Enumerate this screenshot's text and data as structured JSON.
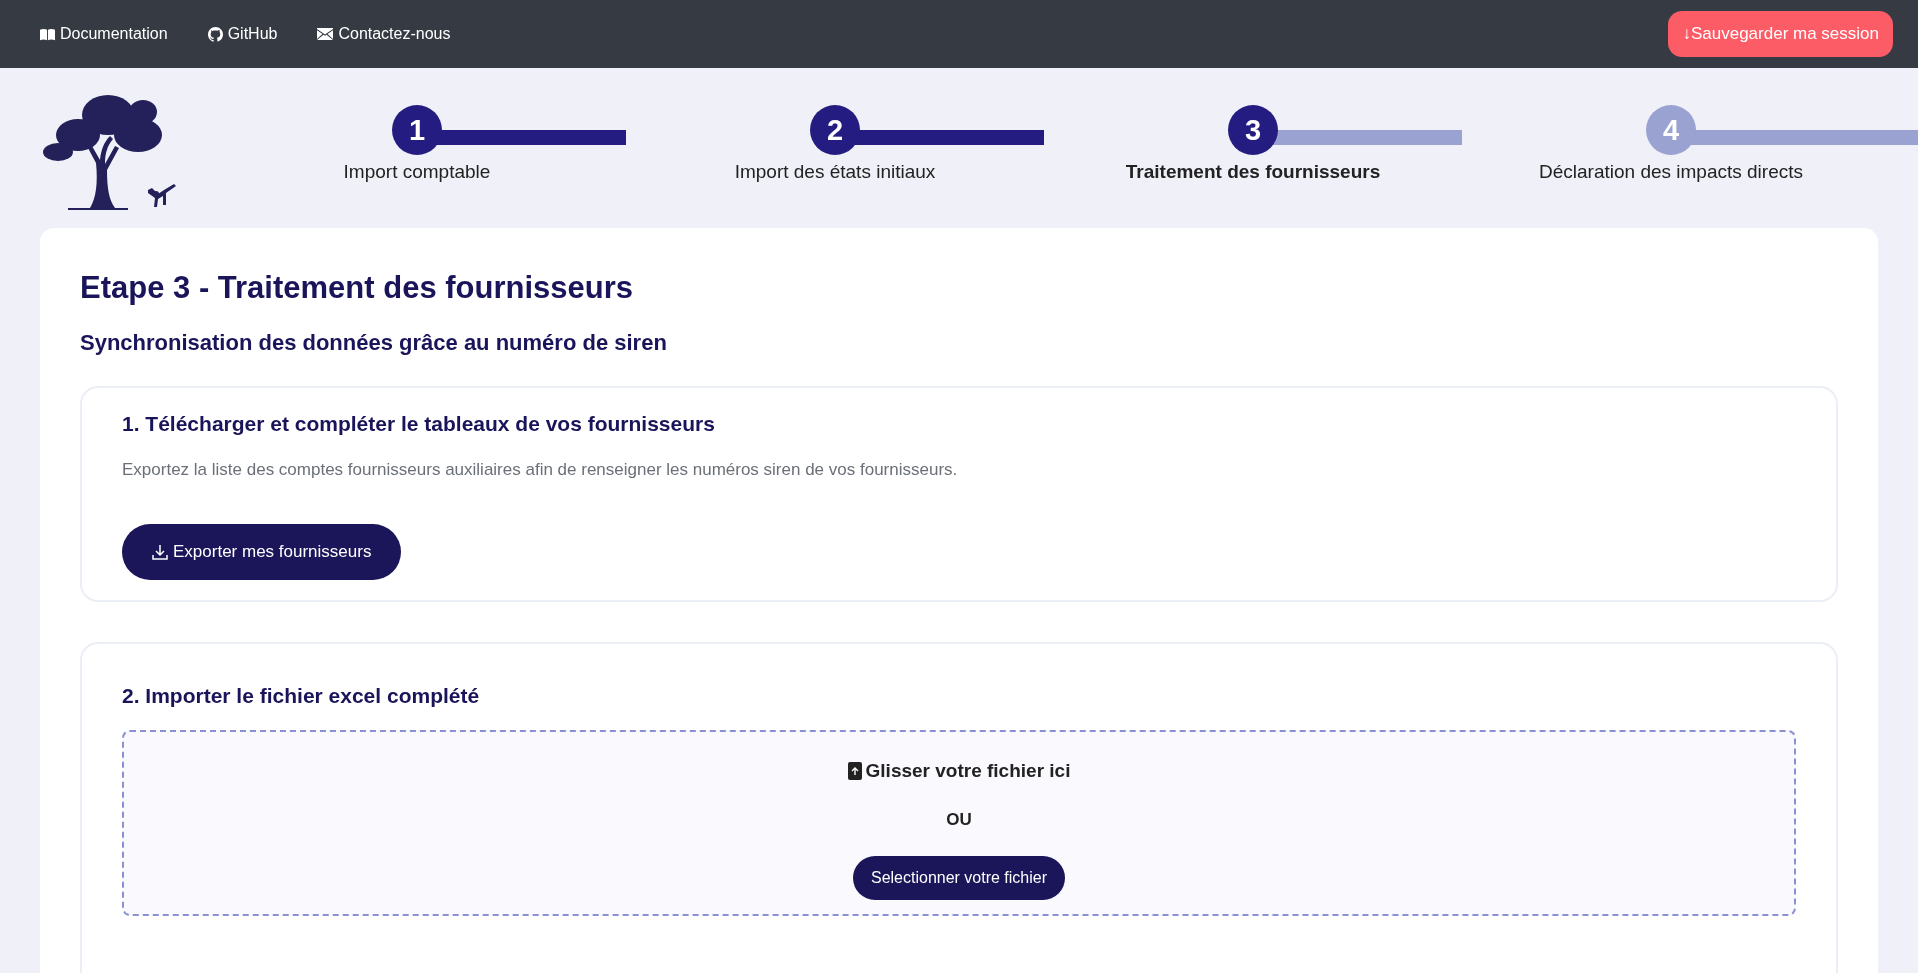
{
  "top_nav": {
    "links": [
      {
        "label": "Documentation",
        "kind": "book"
      },
      {
        "label": "GitHub",
        "kind": "github"
      },
      {
        "label": "Contactez-nous",
        "kind": "mail"
      }
    ],
    "save_button": {
      "arrow": "↓",
      "label": "Sauvegarder ma session"
    }
  },
  "stepper": [
    {
      "number": "1",
      "label": "Import comptable",
      "completed": true,
      "selected": false
    },
    {
      "number": "2",
      "label": "Import des états initiaux",
      "completed": true,
      "selected": false
    },
    {
      "number": "3",
      "label": "Traitement des fournisseurs",
      "completed": false,
      "selected": true
    },
    {
      "number": "4",
      "label": "Déclaration des impacts directs",
      "completed": false,
      "selected": false
    }
  ],
  "main": {
    "title": "Etape 3 - Traitement des fournisseurs",
    "subtitle": "Synchronisation des données grâce au numéro de siren",
    "export_section": {
      "heading": "1. Télécharger et compléter le tableaux de vos fournisseurs",
      "description": "Exportez la liste des comptes fournisseurs auxiliaires afin de renseigner les numéros siren de vos fournisseurs.",
      "button": "Exporter mes fournisseurs"
    },
    "import_section": {
      "heading": "2. Importer le fichier excel complété",
      "drop_text": "Glisser votre fichier ici",
      "separator": "OU",
      "button": "Selectionner votre fichier"
    }
  }
}
